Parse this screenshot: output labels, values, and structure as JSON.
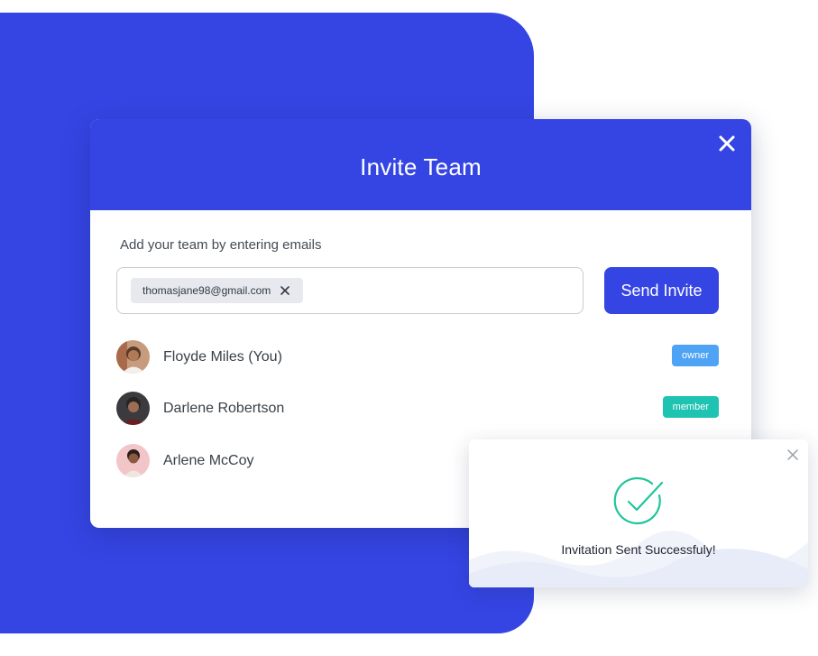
{
  "modal": {
    "title": "Invite Team",
    "instructions": "Add your team by entering emails",
    "email_chip": "thomasjane98@gmail.com",
    "send_label": "Send Invite"
  },
  "members": [
    {
      "name": "Floyde Miles (You)",
      "role": "owner",
      "role_color": "#4ea3f5"
    },
    {
      "name": "Darlene Robertson",
      "role": "member",
      "role_color": "#1ec3b1"
    },
    {
      "name": "Arlene McCoy"
    }
  ],
  "toast": {
    "message": "Invitation Sent Successfuly!"
  },
  "colors": {
    "brand": "#3545e3",
    "success": "#1fc59b"
  },
  "icons": [
    "close-icon",
    "remove-chip-icon",
    "success-check-icon",
    "toast-close-icon"
  ]
}
